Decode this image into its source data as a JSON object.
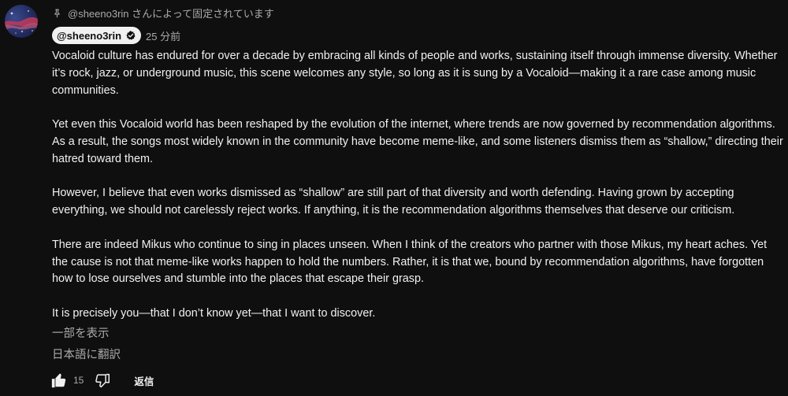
{
  "pinned": {
    "text": "@sheeno3rin さんによって固定されています",
    "icon": "pin-icon"
  },
  "comment": {
    "author": "@sheeno3rin",
    "author_badge_icon": "verified-icon",
    "timestamp": "25 分前",
    "paragraphs": [
      "Vocaloid culture has endured for over a decade by embracing all kinds of people and works, sustaining itself through immense diversity. Whether it’s rock, jazz, or underground music, this scene welcomes any style, so long as it is sung by a Vocaloid—making it a rare case among music communities.",
      "Yet even this Vocaloid world has been reshaped by the evolution of the internet, where trends are now governed by recommendation algorithms. As a result, the songs most widely known in the community have become meme-like, and some listeners dismiss them as “shallow,” directing their hatred toward them.",
      "However, I believe that even works dismissed as “shallow” are still part of that diversity and worth defending. Having grown by accepting everything, we should not carelessly reject works. If anything, it is the recommendation algorithms themselves that deserve our criticism.",
      "There are indeed Mikus who continue to sing in places unseen. When I think of the creators who partner with those Mikus, my heart aches. Yet the cause is not that meme-like works happen to hold the numbers. Rather, it is that we, bound by recommendation algorithms, have forgotten how to lose ourselves and stumble into the places that escape their grasp.",
      "It is precisely you—that I don’t know yet—that I want to discover."
    ],
    "show_more_label": "一部を表示",
    "translate_label": "日本語に翻訳"
  },
  "actions": {
    "like_icon": "thumbs-up-icon",
    "like_count": "15",
    "dislike_icon": "thumbs-down-icon",
    "reply_label": "返信"
  },
  "colors": {
    "background": "#0f0f0f",
    "text_primary": "#f1f1f1",
    "text_secondary": "#aaaaaa",
    "chip_background": "#f1f1f1"
  }
}
